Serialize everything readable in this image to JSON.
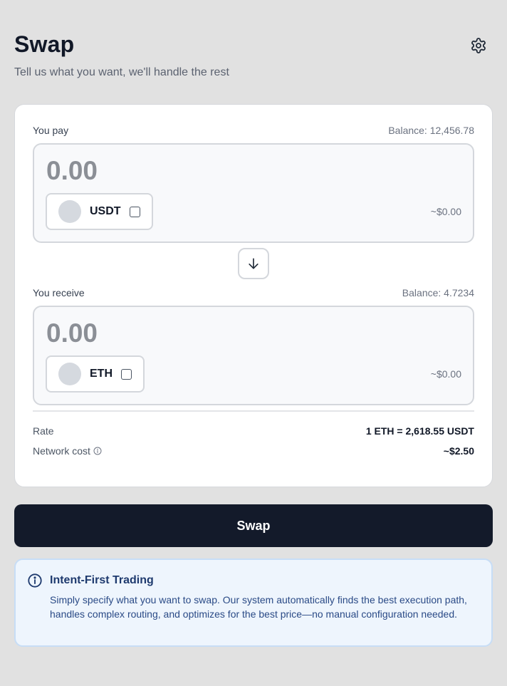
{
  "header": {
    "title": "Swap",
    "subtitle": "Tell us what you want, we'll handle the rest"
  },
  "pay": {
    "label": "You pay",
    "balance": "Balance: 12,456.78",
    "amount_placeholder": "0.00",
    "token_symbol": "USDT",
    "usd_value": "~$0.00"
  },
  "receive": {
    "label": "You receive",
    "balance": "Balance: 4.7234",
    "amount_placeholder": "0.00",
    "token_symbol": "ETH",
    "usd_value": "~$0.00"
  },
  "details": {
    "rate_label": "Rate",
    "rate_value": "1 ETH = 2,618.55 USDT",
    "network_cost_label": "Network cost",
    "network_cost_value": "~$2.50"
  },
  "actions": {
    "swap_label": "Swap"
  },
  "info": {
    "title": "Intent-First Trading",
    "text": "Simply specify what you want to swap. Our system automatically finds the best execution path, handles complex routing, and optimizes for the best price—no manual configuration needed."
  },
  "icons": {
    "settings": "gear-icon",
    "flip": "arrow-down-icon",
    "info": "info-circle-icon"
  },
  "colors": {
    "background": "#e1e1e1",
    "primary_button": "#131a2a",
    "info_background": "#eef5fd",
    "info_border": "#c7ddf6",
    "info_title": "#1e3a6e"
  }
}
